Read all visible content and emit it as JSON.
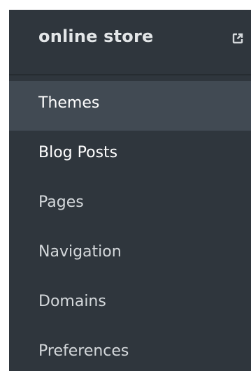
{
  "sidebar": {
    "store_name": "online store",
    "external_icon": "external-link-icon",
    "items": [
      {
        "label": "Themes",
        "active": true
      },
      {
        "label": "Blog Posts",
        "active": false
      },
      {
        "label": "Pages",
        "active": false
      },
      {
        "label": "Navigation",
        "active": false
      },
      {
        "label": "Domains",
        "active": false
      },
      {
        "label": "Preferences",
        "active": false
      }
    ]
  },
  "colors": {
    "sidebar_bg": "#2f363d",
    "active_item_bg": "#414a53",
    "text": "#d4d8db",
    "title": "#e3e6e8"
  }
}
